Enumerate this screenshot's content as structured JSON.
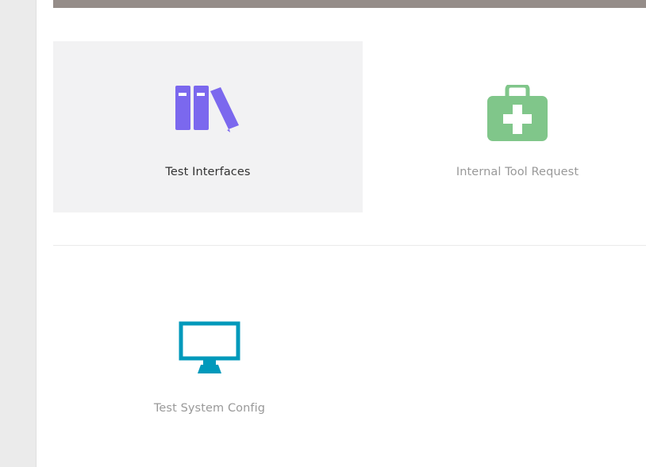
{
  "tiles": [
    {
      "label": "Test Interfaces",
      "icon": "books-icon",
      "color": "#7b68ee"
    },
    {
      "label": "Internal Tool Request",
      "icon": "first-aid-kit-icon",
      "color": "#80c68a"
    },
    {
      "label": "Test System Config",
      "icon": "monitor-icon",
      "color": "#0099bb"
    }
  ],
  "colors": {
    "top_bar": "#958d89",
    "tile_hover_bg": "#f2f2f3",
    "rail_bg": "#ebebeb"
  }
}
